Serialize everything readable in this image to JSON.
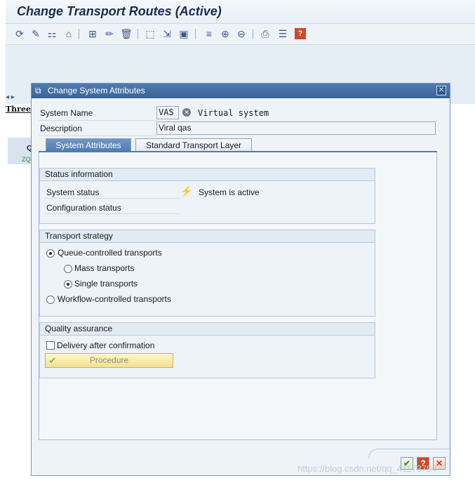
{
  "app": {
    "title": "Change Transport Routes (Active)"
  },
  "toolbar": {
    "icons": [
      "refresh-icon",
      "glasses-icon",
      "hierarchy-icon",
      "transport-layer-icon",
      "add-system-icon",
      "edit-icon",
      "delete-icon",
      "select-area-icon",
      "move-icon",
      "package-icon",
      "align-icon",
      "zoom-in-icon",
      "zoom-out-icon",
      "print-icon",
      "list-icon",
      "help-icon"
    ]
  },
  "background": {
    "left_text": "Three",
    "block_letter": "Q",
    "block_code": "ZQ"
  },
  "dialog": {
    "title": "Change System Attributes",
    "system_name_label": "System Name",
    "system_name_value": "VAS",
    "system_type": "Virtual system",
    "description_label": "Description",
    "description_value": "Viral qas",
    "tabs": [
      {
        "label": "System Attributes",
        "active": true
      },
      {
        "label": "Standard Transport Layer",
        "active": false
      }
    ],
    "status_group": {
      "title": "Status information",
      "system_status_label": "System status",
      "system_status_value": "System is active",
      "config_status_label": "Configuration status"
    },
    "strategy_group": {
      "title": "Transport strategy",
      "options": [
        {
          "label": "Queue-controlled transports",
          "selected": true
        },
        {
          "label": "Mass transports",
          "selected": false
        },
        {
          "label": "Single transports",
          "selected": true
        },
        {
          "label": "Workflow-controlled transports",
          "selected": false
        }
      ]
    },
    "qa_group": {
      "title": "Quality assurance",
      "delivery_label": "Delivery after confirmation",
      "delivery_checked": false,
      "procedure_label": "Procedure"
    },
    "footer": {
      "confirm_icon": "check-icon",
      "help_icon": "help-icon",
      "cancel_icon": "cancel-icon"
    }
  },
  "watermark": "https://blog.csdn.net/qq_41173794",
  "colors": {
    "header_blue": "#3b6498",
    "tab_active": "#4f7bb0",
    "procedure_yellow": "#f3e08e",
    "confirm_green": "#3a9a2a",
    "cancel_red": "#d03a1a"
  }
}
